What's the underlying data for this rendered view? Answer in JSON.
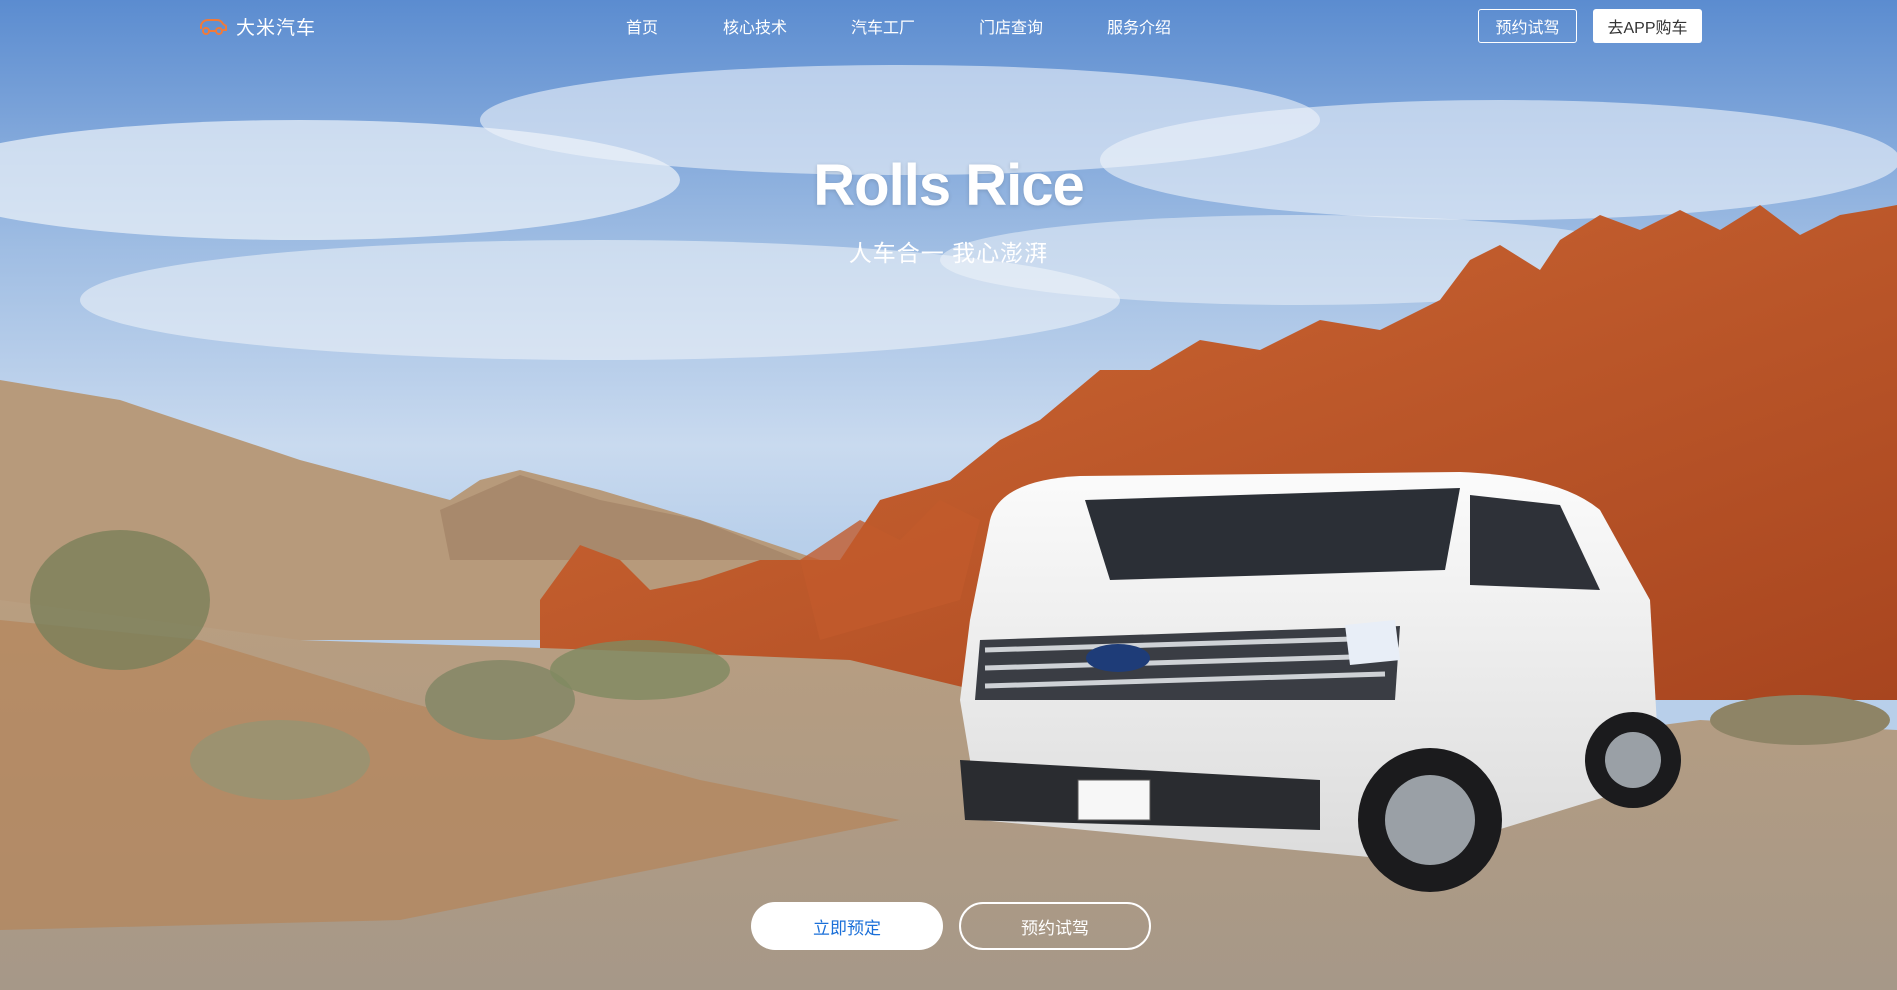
{
  "brand": {
    "name": "大米汽车",
    "icon": "car-icon",
    "accent": "#f07a3a"
  },
  "nav": {
    "items": [
      "首页",
      "核心技术",
      "汽车工厂",
      "门店查询",
      "服务介绍"
    ]
  },
  "header_buttons": {
    "test_drive": "预约试驾",
    "app_buy": "去APP购车"
  },
  "hero": {
    "title": "Rolls Rice",
    "subtitle": "人车合一 我心澎湃",
    "primary_button": "立即预定",
    "secondary_button": "预约试驾",
    "primary_color": "#1a6fd8"
  }
}
